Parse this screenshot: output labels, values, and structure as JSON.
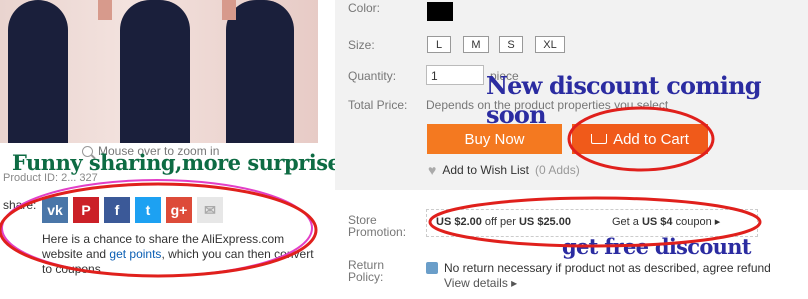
{
  "zoom_hint": "Mouse over to zoom in",
  "funny_caption": "Funny sharing,more surprise",
  "product_id": "Product ID: 2... 327",
  "share": {
    "label": "share:",
    "icons": [
      "vk-icon",
      "pinterest-icon",
      "facebook-icon",
      "twitter-icon",
      "google-plus-icon",
      "email-icon"
    ],
    "icon_glyphs": [
      "vk",
      "P",
      "f",
      "t",
      "g+",
      "✉"
    ],
    "desc_1": "Here is a chance to share the AliExpress.com website and",
    "link": "get points",
    "desc_2": ", which you can then convert to coupons."
  },
  "labels": {
    "color": "Color:",
    "size": "Size:",
    "quantity": "Quantity:",
    "total_price": "Total Price:",
    "store_promotion": "Store Promotion:",
    "return_policy": "Return Policy:"
  },
  "sizes": [
    "L",
    "M",
    "S",
    "XL"
  ],
  "quantity_value": "1",
  "piece": "piece",
  "total_price_text": "Depends on the product properties you select",
  "new_discount_caption": "New discount coming soon",
  "buttons": {
    "buy_now": "Buy Now",
    "add_to_cart": "Add to Cart"
  },
  "wishlist": {
    "label": "Add to Wish List",
    "count": "(0 Adds)"
  },
  "promotion": {
    "amount": "US $2.00",
    "mid": " off per ",
    "threshold": "US $25.00",
    "coupon_pre": "Get a ",
    "coupon_amount": "US $4",
    "coupon_post": " coupon ▸"
  },
  "get_free_caption": "get free discount",
  "return_policy": {
    "text": "No return necessary if product not as described, agree refund",
    "view_details": "View details ▸"
  },
  "colors": {
    "annotation_red": "#e0201c",
    "annotation_magenta": "#e23fc7",
    "buy_orange": "#f47920"
  }
}
